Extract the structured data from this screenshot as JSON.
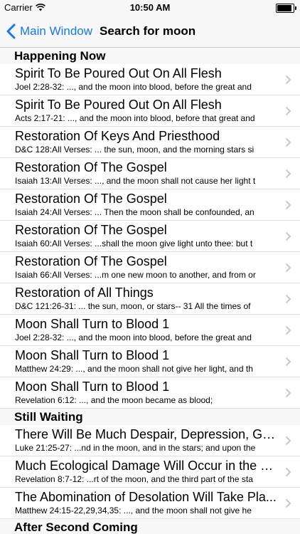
{
  "status_bar": {
    "carrier": "Carrier",
    "time": "10:50 AM"
  },
  "nav": {
    "back_label": "Main Window",
    "title": "Search for moon"
  },
  "sections": [
    {
      "header": "Happening Now",
      "rows": [
        {
          "title": "Spirit To Be Poured Out On All Flesh",
          "subtitle": "Joel 2:28-32: ..., and the moon into blood, before the great and"
        },
        {
          "title": "Spirit To Be Poured Out On All Flesh",
          "subtitle": "Acts 2:17-21: ..., and the moon into blood, before that great and"
        },
        {
          "title": "Restoration Of Keys And Priesthood",
          "subtitle": "D&C 128:All Verses: ... the sun, moon, and the morning stars si"
        },
        {
          "title": "Restoration Of The Gospel",
          "subtitle": "Isaiah 13:All Verses: ..., and the moon shall not cause her light t"
        },
        {
          "title": "Restoration Of The Gospel",
          "subtitle": "Isaiah 24:All Verses: ... Then the moon shall be confounded, an"
        },
        {
          "title": "Restoration Of The Gospel",
          "subtitle": "Isaiah 60:All Verses: ...shall the moon give light unto thee: but t"
        },
        {
          "title": "Restoration Of The Gospel",
          "subtitle": "Isaiah 66:All Verses: ...m one new moon to another, and from or"
        },
        {
          "title": "Restoration of All Things",
          "subtitle": "D&C 121:26-31: ... the sun, moon, or stars-- 31 All the times of"
        },
        {
          "title": "Moon Shall Turn to Blood 1",
          "subtitle": "Joel 2:28-32: ..., and the moon into blood, before the great and"
        },
        {
          "title": "Moon Shall Turn to Blood 1",
          "subtitle": "Matthew 24:29: ..., and the moon shall not give her light, and th"
        },
        {
          "title": "Moon Shall Turn to Blood 1",
          "subtitle": "Revelation 6:12: ..., and the moon became as blood;"
        }
      ]
    },
    {
      "header": "Still Waiting",
      "rows": [
        {
          "title": "There Will Be Much Despair, Depression, Glo...",
          "subtitle": "Luke 21:25-27: ...nd in the moon, and in the stars; and upon the"
        },
        {
          "title": "Much Ecological Damage Will Occur in the L...",
          "subtitle": "Revelation 8:7-12: ...rt of the moon, and the third part of the sta"
        },
        {
          "title": "The Abomination of Desolation Will Take Pla...",
          "subtitle": "Matthew 24:15-22,29,34,35: ..., and the moon shall not give he"
        }
      ]
    },
    {
      "header": "After Second Coming",
      "rows": []
    }
  ],
  "colors": {
    "accent": "#1478f0",
    "bar_background": "#f7f7f7",
    "chevron": "#c7c7cc"
  },
  "icons": {
    "wifi": "wifi-icon",
    "battery": "battery-icon",
    "back": "back-chevron-icon",
    "disclosure": "chevron-right-icon"
  }
}
